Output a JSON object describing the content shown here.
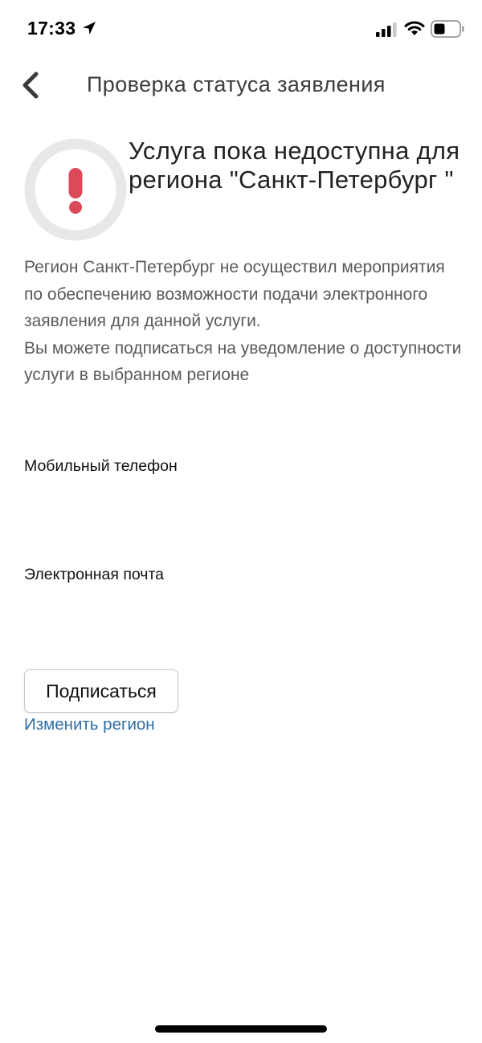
{
  "status_bar": {
    "time": "17:33",
    "icons": [
      "location-arrow-icon",
      "cellular-signal-icon",
      "wifi-icon",
      "battery-icon"
    ]
  },
  "header": {
    "title": "Проверка статуса заявления",
    "back_icon": "chevron-left-icon"
  },
  "alert": {
    "icon": "exclamation-icon",
    "title": "Услуга пока недоступна для региона \"Санкт-Петербург \"",
    "icon_color": "#dc4a5a",
    "ring_color": "#e6e8ea"
  },
  "message": {
    "paragraph_1": "Регион Санкт-Петербург не осуществил мероприятия по обеспечению возможности подачи электронного заявления для данной услуги.",
    "paragraph_2": "Вы можете подписаться на уведомление о доступности услуги в выбранном регионе"
  },
  "form": {
    "phone_label": "Мобильный телефон",
    "phone_value": "",
    "email_label": "Электронная почта",
    "email_value": "",
    "subscribe_label": "Подписаться",
    "change_region_label": "Изменить регион"
  },
  "colors": {
    "link": "#2f6ea6",
    "text_secondary": "#5a5a5a"
  }
}
